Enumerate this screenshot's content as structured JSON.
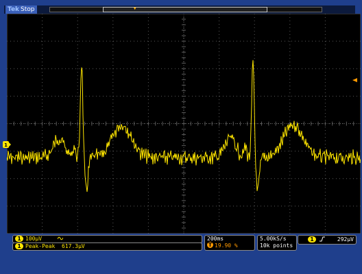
{
  "status": {
    "brand": "Tek",
    "state": "Stop"
  },
  "markers": {
    "channel": "1",
    "trigger": "T"
  },
  "readout": {
    "channel_scale": "100µV",
    "bandwidth_icon": "bandwidth-limit-icon",
    "measurement_label": "Peak-Peak",
    "measurement_value": "617.3µV",
    "timebase": "200ms",
    "trigger_position": "19.90 %",
    "sample_rate": "5.00kS/s",
    "record_length": "10k points",
    "trigger_slope_icon": "rising-edge-icon",
    "trigger_level": "292µV"
  },
  "colors": {
    "trace": "#ffe600",
    "trigger": "#ff9a00",
    "background": "#1f3f8c",
    "grid": "#5a5a5a"
  }
}
